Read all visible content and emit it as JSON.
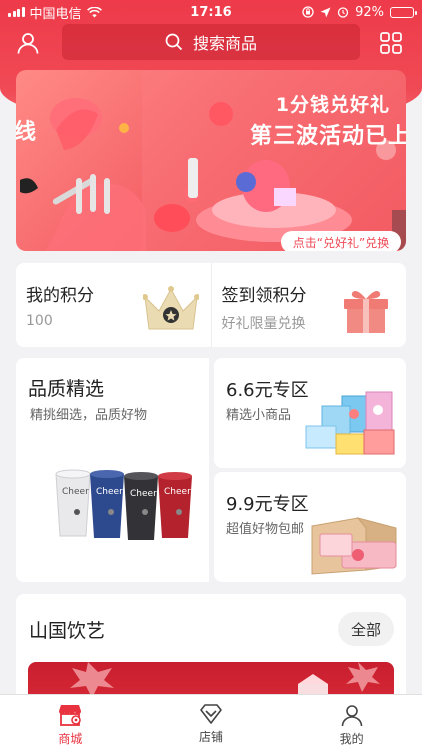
{
  "status_bar": {
    "carrier": "中国电信",
    "time": "17:16",
    "battery": "92%",
    "battery_level": 0.92
  },
  "header": {
    "search_placeholder": "搜索商品"
  },
  "banner": {
    "title_line1": "1分钱兑好礼",
    "title_line2": "第三波活动已上",
    "left_fragment": "线",
    "cta": "点击“兑好礼”兑换"
  },
  "points": {
    "my_points_label": "我的积分",
    "my_points_value": "100",
    "signin_label": "签到领积分",
    "signin_sub": "好礼限量兑换"
  },
  "quality": {
    "title": "品质精选",
    "subtitle": "精挑细选，品质好物",
    "product_brand": "Cheer"
  },
  "zones": [
    {
      "title": "6.6元专区",
      "subtitle": "精选小商品"
    },
    {
      "title": "9.9元专区",
      "subtitle": "超值好物包邮"
    }
  ],
  "shop_section": {
    "title": "山国饮艺",
    "all_label": "全部"
  },
  "tabbar": {
    "items": [
      {
        "label": "商城",
        "icon": "mall-icon",
        "active": true
      },
      {
        "label": "店铺",
        "icon": "shop-diamond-icon",
        "active": false
      },
      {
        "label": "我的",
        "icon": "profile-icon",
        "active": false
      }
    ],
    "active_color": "#e8323f"
  },
  "colors": {
    "brand_red": "#ee3a4a"
  }
}
